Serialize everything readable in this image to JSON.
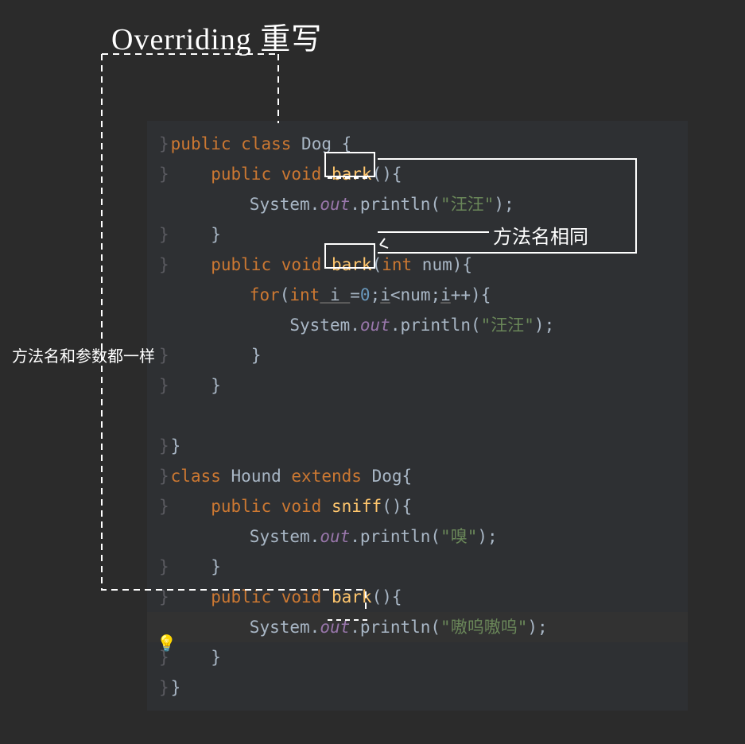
{
  "annotations": {
    "title": "Overriding 重写",
    "method_name_same": "方法名相同",
    "method_and_params_same": "方法名和参数都一样"
  },
  "code": {
    "dog_class": {
      "decl_public": "public",
      "decl_class": "class",
      "name": "Dog",
      "open_brace": " {",
      "bark1": {
        "public": "public",
        "void": "void",
        "name": "bark",
        "params": "()",
        "open": "{",
        "sys": "System.",
        "out": "out",
        "println": ".println(",
        "str": "\"汪汪\"",
        "end": ");",
        "close": "}"
      },
      "bark2": {
        "public": "public",
        "void": "void",
        "name": "bark",
        "params_open": "(",
        "int_kw": "int",
        "param_name": " num",
        "params_close": ")",
        "open": "{",
        "for_kw": "for",
        "for_open": "(",
        "int_kw2": "int",
        "i_init": " i ",
        "eq": "=",
        "zero": "0",
        "semi1": ";",
        "i_var": "i",
        "lt": "<num;",
        "i_var2": "i",
        "inc": "++){",
        "sys": "System.",
        "out": "out",
        "println": ".println(",
        "str": "\"汪汪\"",
        "end": ");",
        "for_close": "}",
        "close": "}"
      },
      "close": "}"
    },
    "hound_class": {
      "decl_class": "class",
      "name": "Hound",
      "extends_kw": "extends",
      "parent": "Dog",
      "open": "{",
      "sniff": {
        "public": "public",
        "void": "void",
        "name": "sniff",
        "params": "()",
        "open": "{",
        "sys": "System.",
        "out": "out",
        "println": ".println(",
        "str": "\"嗅\"",
        "end": ");",
        "close": "}"
      },
      "bark": {
        "public": "public",
        "void": "void",
        "name": "bark",
        "params": "()",
        "open": "{",
        "sys": "System.",
        "out": "out",
        "println": ".println(",
        "str": "\"嗷呜嗷呜\"",
        "end": ");",
        "close": "}"
      },
      "close": "}"
    }
  },
  "bulb_icon": "💡"
}
